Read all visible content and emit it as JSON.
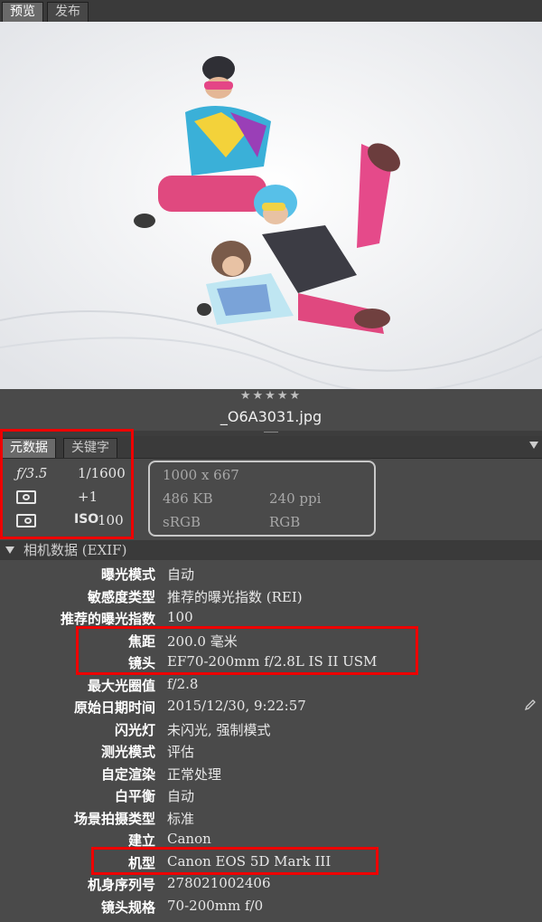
{
  "tabs_top": [
    "预览",
    "发布"
  ],
  "preview": {
    "rating": "★★★★★",
    "filename": "_O6A3031.jpg"
  },
  "meta_tabs": [
    "元数据",
    "关键字"
  ],
  "summary": {
    "aperture": "ƒ/3.5",
    "shutter": "1/1600",
    "exposure_comp": "+1",
    "iso_prefix": "ISO",
    "iso": "100",
    "dimensions": "1000 x 667",
    "file_size": "486 KB",
    "resolution": "240 ppi",
    "color_profile": "sRGB",
    "color_mode": "RGB"
  },
  "section_title": "相机数据 (EXIF)",
  "exif": [
    {
      "label": "曝光模式",
      "value": "自动"
    },
    {
      "label": "敏感度类型",
      "value": "推荐的曝光指数 (REI)"
    },
    {
      "label": "推荐的曝光指数",
      "value": "100"
    },
    {
      "label": "焦距",
      "value": "200.0 毫米"
    },
    {
      "label": "镜头",
      "value": "EF70-200mm f/2.8L IS II USM"
    },
    {
      "label": "最大光圈值",
      "value": "f/2.8"
    },
    {
      "label": "原始日期时间",
      "value": "2015/12/30, 9:22:57"
    },
    {
      "label": "闪光灯",
      "value": "未闪光, 强制模式"
    },
    {
      "label": "测光模式",
      "value": "评估"
    },
    {
      "label": "自定渲染",
      "value": "正常处理"
    },
    {
      "label": "白平衡",
      "value": "自动"
    },
    {
      "label": "场景拍摄类型",
      "value": "标准"
    },
    {
      "label": "建立",
      "value": "Canon"
    },
    {
      "label": "机型",
      "value": "Canon EOS 5D Mark III"
    },
    {
      "label": "机身序列号",
      "value": "278021002406"
    },
    {
      "label": "镜头规格",
      "value": "70-200mm f/0"
    }
  ],
  "colors": {
    "highlight": "#e00000",
    "panel": "#4a4a4a"
  }
}
